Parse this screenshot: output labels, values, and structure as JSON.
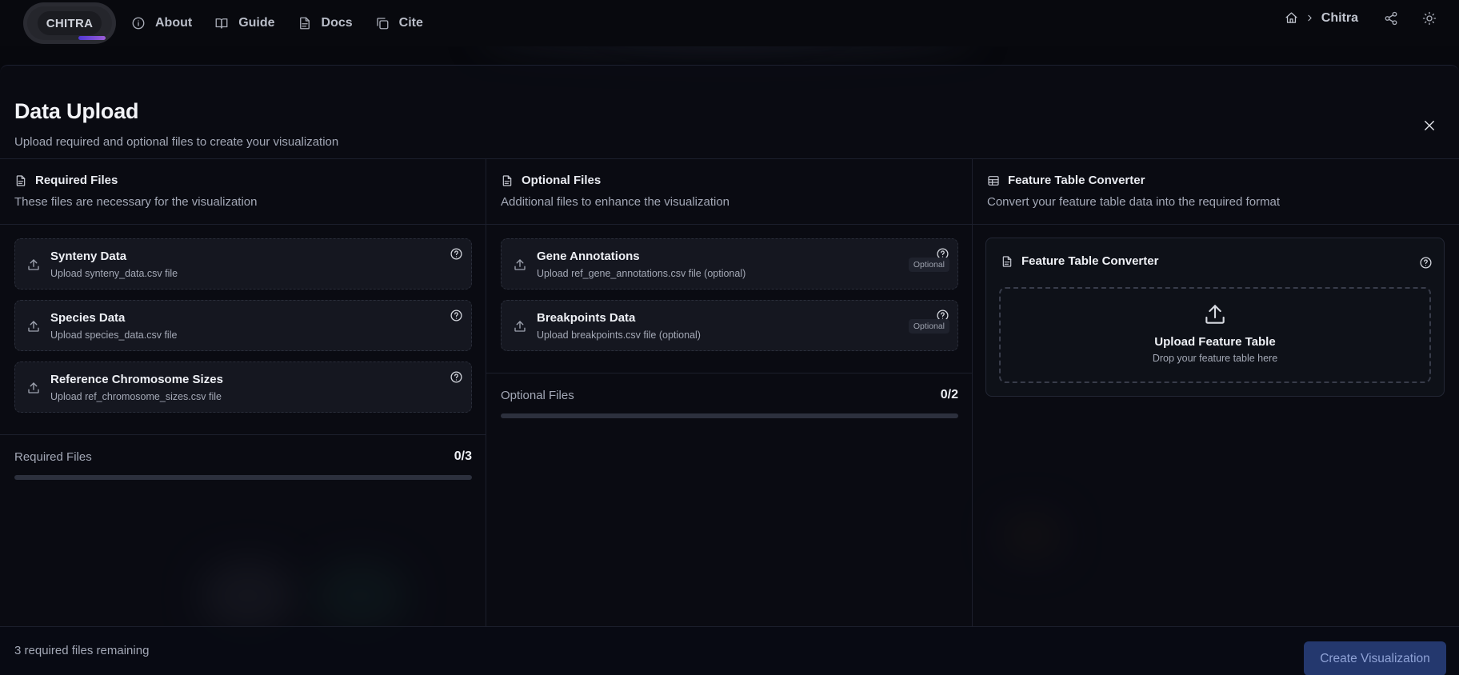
{
  "navbar": {
    "logo": "CHITRA",
    "items": [
      {
        "label": "About",
        "icon": "info-icon"
      },
      {
        "label": "Guide",
        "icon": "book-icon"
      },
      {
        "label": "Docs",
        "icon": "document-icon"
      },
      {
        "label": "Cite",
        "icon": "copy-icon"
      }
    ],
    "breadcrumb": "Chitra"
  },
  "modal": {
    "title": "Data Upload",
    "subtitle": "Upload required and optional files to create your visualization",
    "required": {
      "title": "Required Files",
      "subtitle": "These files are necessary for the visualization",
      "files": [
        {
          "name": "Synteny Data",
          "desc": "Upload synteny_data.csv file"
        },
        {
          "name": "Species Data",
          "desc": "Upload species_data.csv file"
        },
        {
          "name": "Reference Chromosome Sizes",
          "desc": "Upload ref_chromosome_sizes.csv file"
        }
      ],
      "progress_label": "Required Files",
      "progress_count": "0/3",
      "progress_value": 0
    },
    "optional": {
      "title": "Optional Files",
      "subtitle": "Additional files to enhance the visualization",
      "badge": "Optional",
      "files": [
        {
          "name": "Gene Annotations",
          "desc": "Upload ref_gene_annotations.csv file (optional)"
        },
        {
          "name": "Breakpoints Data",
          "desc": "Upload breakpoints.csv file (optional)"
        }
      ],
      "progress_label": "Optional Files",
      "progress_count": "0/2",
      "progress_value": 0
    },
    "converter": {
      "title": "Feature Table Converter",
      "subtitle": "Convert your feature table data into the required format",
      "card_title": "Feature Table Converter",
      "drop_title": "Upload Feature Table",
      "drop_sub": "Drop your feature table here"
    },
    "footer": {
      "remaining": "3 required files remaining",
      "create_label": "Create Visualization"
    }
  },
  "colors": {
    "accent": "#5b6cff",
    "create_button_bg": "#24386e",
    "create_button_text": "#8fa2d6"
  }
}
